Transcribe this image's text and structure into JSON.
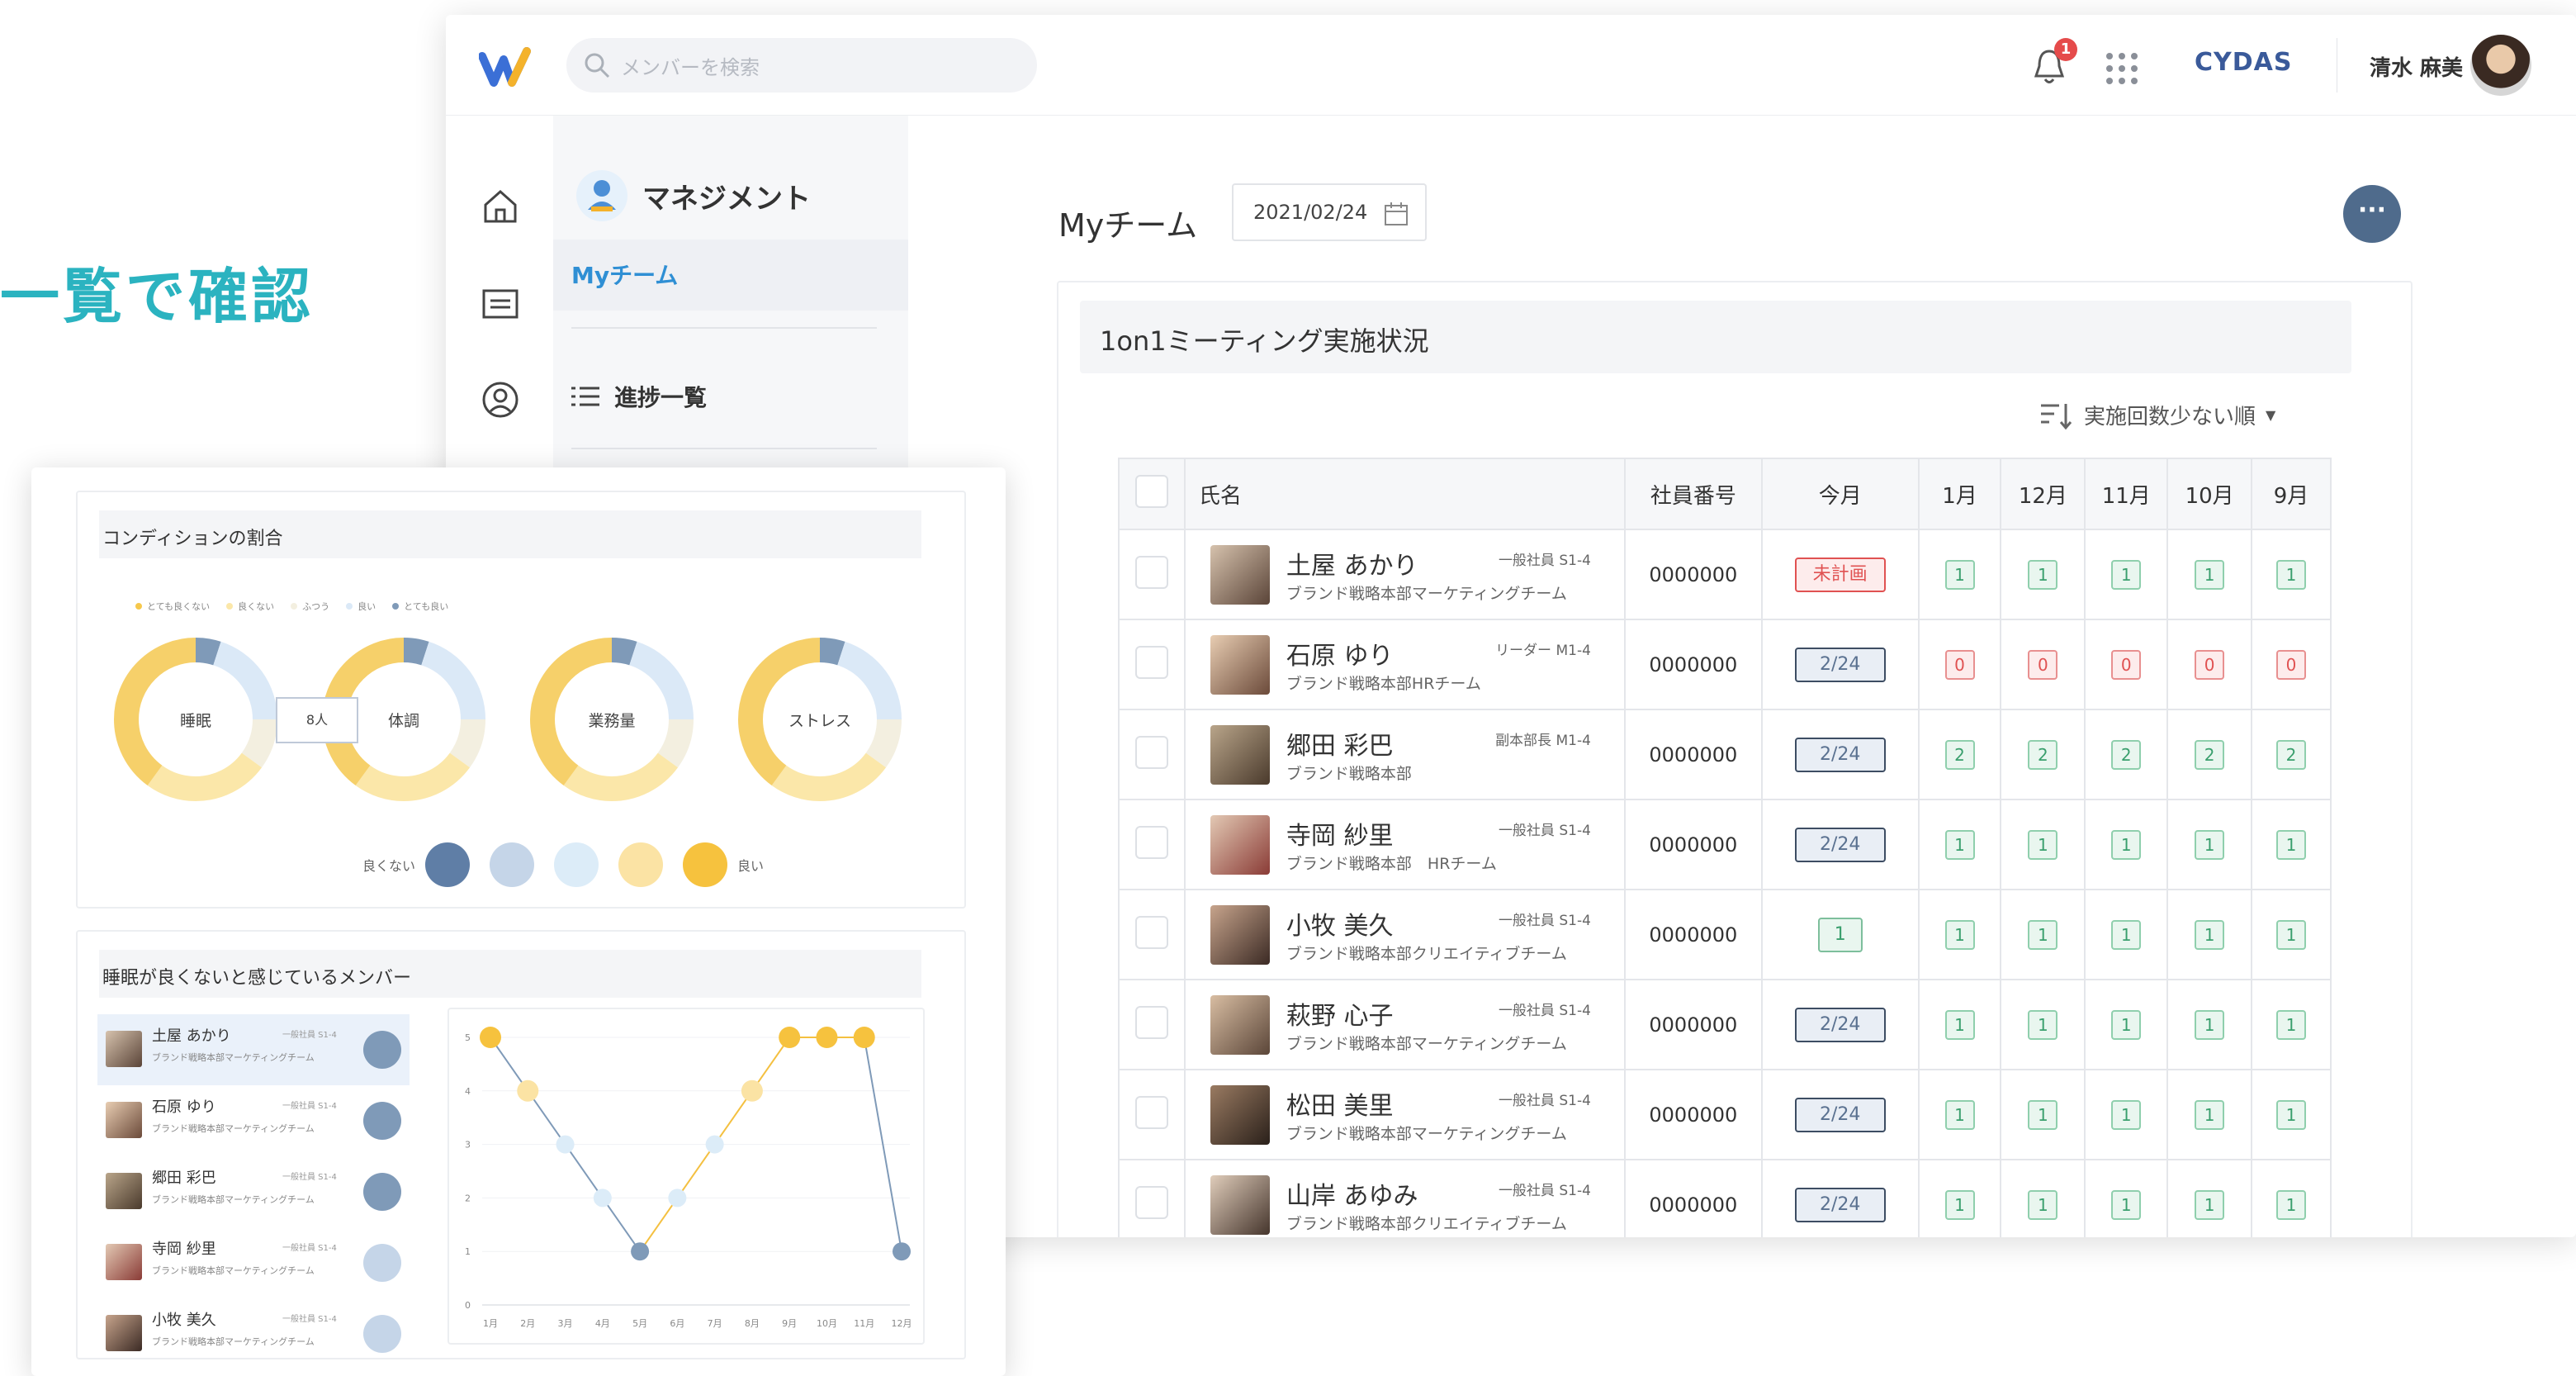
{
  "headline": "一覧で確認",
  "topbar": {
    "search_placeholder": "メンバーを検索",
    "notification_count": "1",
    "brand": "CYDAS",
    "user_name": "清水 麻美"
  },
  "nav": {
    "section_title": "マネジメント",
    "active_item": "Myチーム",
    "list_item": "進捗一覧"
  },
  "page": {
    "title": "Myチーム",
    "date": "2021/02/24",
    "more": "···"
  },
  "panel": {
    "title": "1on1ミーティング実施状況",
    "sort_label": "実施回数少ない順"
  },
  "table": {
    "headers": [
      "氏名",
      "社員番号",
      "今月",
      "1月",
      "12月",
      "11月",
      "10月",
      "9月"
    ],
    "rows": [
      {
        "name": "土屋 あかり",
        "role": "一般社員 S1-4",
        "dept": "ブランド戦略本部マーケティングチーム",
        "id": "0000000",
        "this_month": "未計画",
        "status": "plan",
        "months": [
          "1",
          "1",
          "1",
          "1",
          "1"
        ],
        "tone": "g"
      },
      {
        "name": "石原 ゆり",
        "role": "リーダー M1-4",
        "dept": "ブランド戦略本部HRチーム",
        "id": "0000000",
        "this_month": "2/24",
        "status": "date",
        "months": [
          "0",
          "0",
          "0",
          "0",
          "0"
        ],
        "tone": "r"
      },
      {
        "name": "郷田 彩巴",
        "role": "副本部長 M1-4",
        "dept": "ブランド戦略本部",
        "id": "0000000",
        "this_month": "2/24",
        "status": "date",
        "months": [
          "2",
          "2",
          "2",
          "2",
          "2"
        ],
        "tone": "g"
      },
      {
        "name": "寺岡 紗里",
        "role": "一般社員 S1-4",
        "dept": "ブランド戦略本部　HRチーム",
        "id": "0000000",
        "this_month": "2/24",
        "status": "date",
        "months": [
          "1",
          "1",
          "1",
          "1",
          "1"
        ],
        "tone": "g"
      },
      {
        "name": "小牧 美久",
        "role": "一般社員 S1-4",
        "dept": "ブランド戦略本部クリエイティブチーム",
        "id": "0000000",
        "this_month": "1",
        "status": "cnt",
        "months": [
          "1",
          "1",
          "1",
          "1",
          "1"
        ],
        "tone": "g"
      },
      {
        "name": "萩野 心子",
        "role": "一般社員 S1-4",
        "dept": "ブランド戦略本部マーケティングチーム",
        "id": "0000000",
        "this_month": "2/24",
        "status": "date",
        "months": [
          "1",
          "1",
          "1",
          "1",
          "1"
        ],
        "tone": "g"
      },
      {
        "name": "松田 美里",
        "role": "一般社員 S1-4",
        "dept": "ブランド戦略本部マーケティングチーム",
        "id": "0000000",
        "this_month": "2/24",
        "status": "date",
        "months": [
          "1",
          "1",
          "1",
          "1",
          "1"
        ],
        "tone": "g"
      },
      {
        "name": "山岸 あゆみ",
        "role": "一般社員 S1-4",
        "dept": "ブランド戦略本部クリエイティブチーム",
        "id": "0000000",
        "this_month": "2/24",
        "status": "date",
        "months": [
          "1",
          "1",
          "1",
          "1",
          "1"
        ],
        "tone": "g"
      }
    ]
  },
  "condition": {
    "title": "コンディションの割合",
    "legend": [
      "とても良くない",
      "良くない",
      "ふつう",
      "良い",
      "とても良い"
    ],
    "tooltip": "8人",
    "scale_low": "良くない",
    "scale_high": "良い",
    "donuts": [
      "睡眠",
      "体調",
      "業務量",
      "ストレス"
    ]
  },
  "members": {
    "title": "睡眠が良くないと感じているメンバー",
    "list": [
      {
        "name": "土屋 あかり",
        "role": "一般社員 S1-4",
        "dept": "ブランド戦略本部マーケティングチーム"
      },
      {
        "name": "石原 ゆり",
        "role": "一般社員 S1-4",
        "dept": "ブランド戦略本部マーケティングチーム"
      },
      {
        "name": "郷田 彩巴",
        "role": "一般社員 S1-4",
        "dept": "ブランド戦略本部マーケティングチーム"
      },
      {
        "name": "寺岡 紗里",
        "role": "一般社員 S1-4",
        "dept": "ブランド戦略本部マーケティングチーム"
      },
      {
        "name": "小牧 美久",
        "role": "一般社員 S1-4",
        "dept": "ブランド戦略本部マーケティングチーム"
      }
    ]
  },
  "chart_data": {
    "type": "line",
    "categories": [
      "1月",
      "2月",
      "3月",
      "4月",
      "5月",
      "6月",
      "7月",
      "8月",
      "9月",
      "10月",
      "11月",
      "12月"
    ],
    "values": [
      5,
      4,
      3,
      2,
      1,
      2,
      3,
      4,
      5,
      5,
      5,
      1
    ],
    "ylim": [
      0,
      5
    ],
    "y_ticks": [
      "0",
      "1",
      "2",
      "3",
      "4",
      "5"
    ],
    "line_colors": {
      "rising": "#f4c040",
      "falling": "#7f9ab8"
    }
  }
}
